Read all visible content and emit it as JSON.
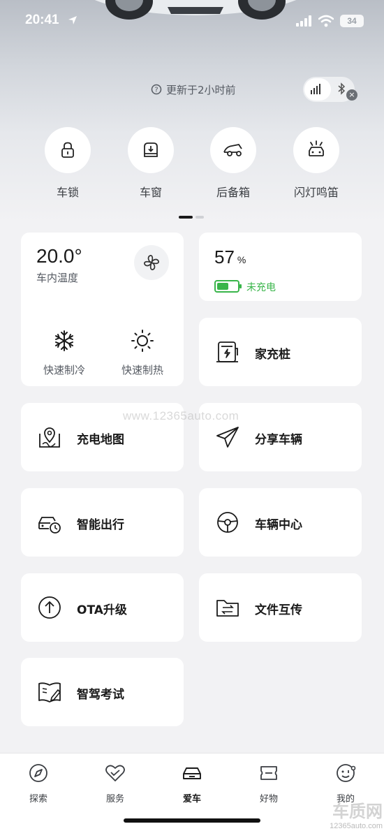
{
  "status_bar": {
    "time": "20:41",
    "battery": "34"
  },
  "header": {
    "update_text": "更新于2小时前",
    "close_glyph": "×"
  },
  "quick_actions": [
    {
      "label": "车锁",
      "icon": "lock-icon"
    },
    {
      "label": "车窗",
      "icon": "window-icon"
    },
    {
      "label": "后备箱",
      "icon": "trunk-icon"
    },
    {
      "label": "闪灯鸣笛",
      "icon": "flash-horn-icon"
    }
  ],
  "climate": {
    "temperature": "20.0°",
    "label": "车内温度",
    "cool_label": "快速制冷",
    "heat_label": "快速制热"
  },
  "battery": {
    "percent": "57",
    "unit": "%",
    "status": "未充电",
    "level": 0.57,
    "status_color": "#39b54a"
  },
  "features": {
    "home_charger": "家充桩",
    "charging_map": "充电地图",
    "share_vehicle": "分享车辆",
    "smart_travel": "智能出行",
    "vehicle_center": "车辆中心",
    "ota_upgrade": "OTA升级",
    "file_transfer": "文件互传",
    "driving_exam": "智驾考试"
  },
  "tabbar": {
    "tabs": [
      {
        "label": "探索",
        "icon": "explore-icon"
      },
      {
        "label": "服务",
        "icon": "service-icon"
      },
      {
        "label": "爱车",
        "icon": "car-icon",
        "active": true
      },
      {
        "label": "好物",
        "icon": "shop-icon"
      },
      {
        "label": "我的",
        "icon": "profile-icon"
      }
    ]
  },
  "watermark": {
    "center": "www.12365auto.com",
    "corner_big": "车质网",
    "corner_small": "12365auto.com"
  }
}
